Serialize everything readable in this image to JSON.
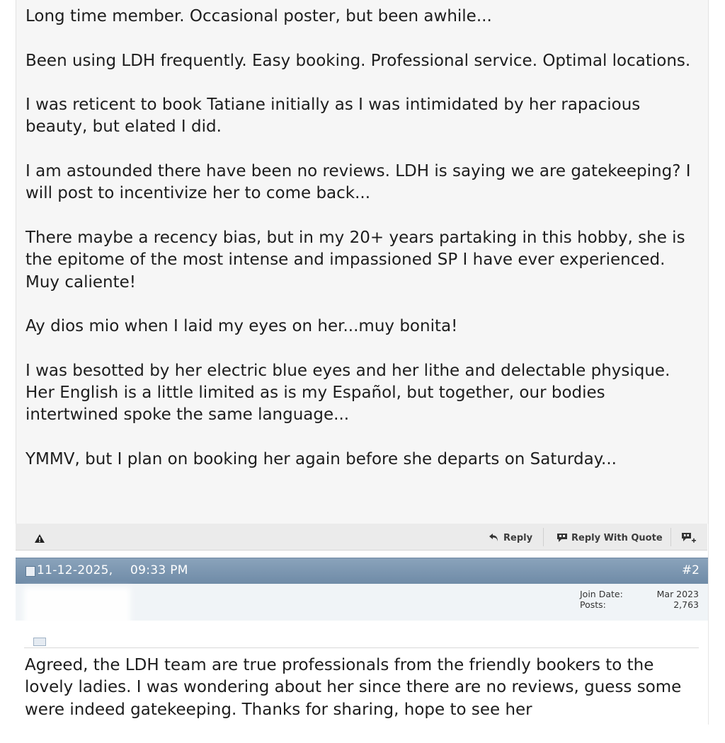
{
  "post1": {
    "paragraphs": [
      "Long time member. Occasional poster, but been awhile...",
      "Been using LDH frequently. Easy booking. Professional service. Optimal locations.",
      "I was reticent to book Tatiane initially as I was intimidated by her rapacious beauty, but elated I did.",
      "I am astounded there have been no reviews. LDH is saying we are gatekeeping? I will post to incentivize her to come back...",
      "There maybe a recency bias, but in my 20+ years partaking in this hobby, she is the epitome of the most intense and impassioned SP I have ever experienced. Muy caliente!",
      "Ay dios mio when I laid my eyes on her...muy bonita!",
      "I was besotted by her electric blue eyes and her lithe and delectable physique. Her English is a little limited as is my Español, but together, our bodies intertwined spoke the same language...",
      "YMMV, but I plan on booking her again before she departs on Saturday..."
    ]
  },
  "actions": {
    "reply_label": "Reply",
    "quote_label": "Reply With Quote"
  },
  "post2": {
    "date": "11-12-2025,",
    "time": "09:33 PM",
    "number": "#2",
    "user_blurred_name": "",
    "user_blurred_title": "",
    "join_date_label": "Join Date:",
    "join_date_value": "Mar 2023",
    "posts_label": "Posts:",
    "posts_value": "2,763",
    "body": "Agreed, the LDH team are true professionals from the friendly bookers to the lovely ladies. I was wondering about her since there are no reviews, guess some were indeed gatekeeping. Thanks for sharing, hope to see her"
  },
  "colors": {
    "header_bar": "#7f99b3",
    "post_bg": "#f6f6f6",
    "action_bar": "#ebebeb"
  }
}
